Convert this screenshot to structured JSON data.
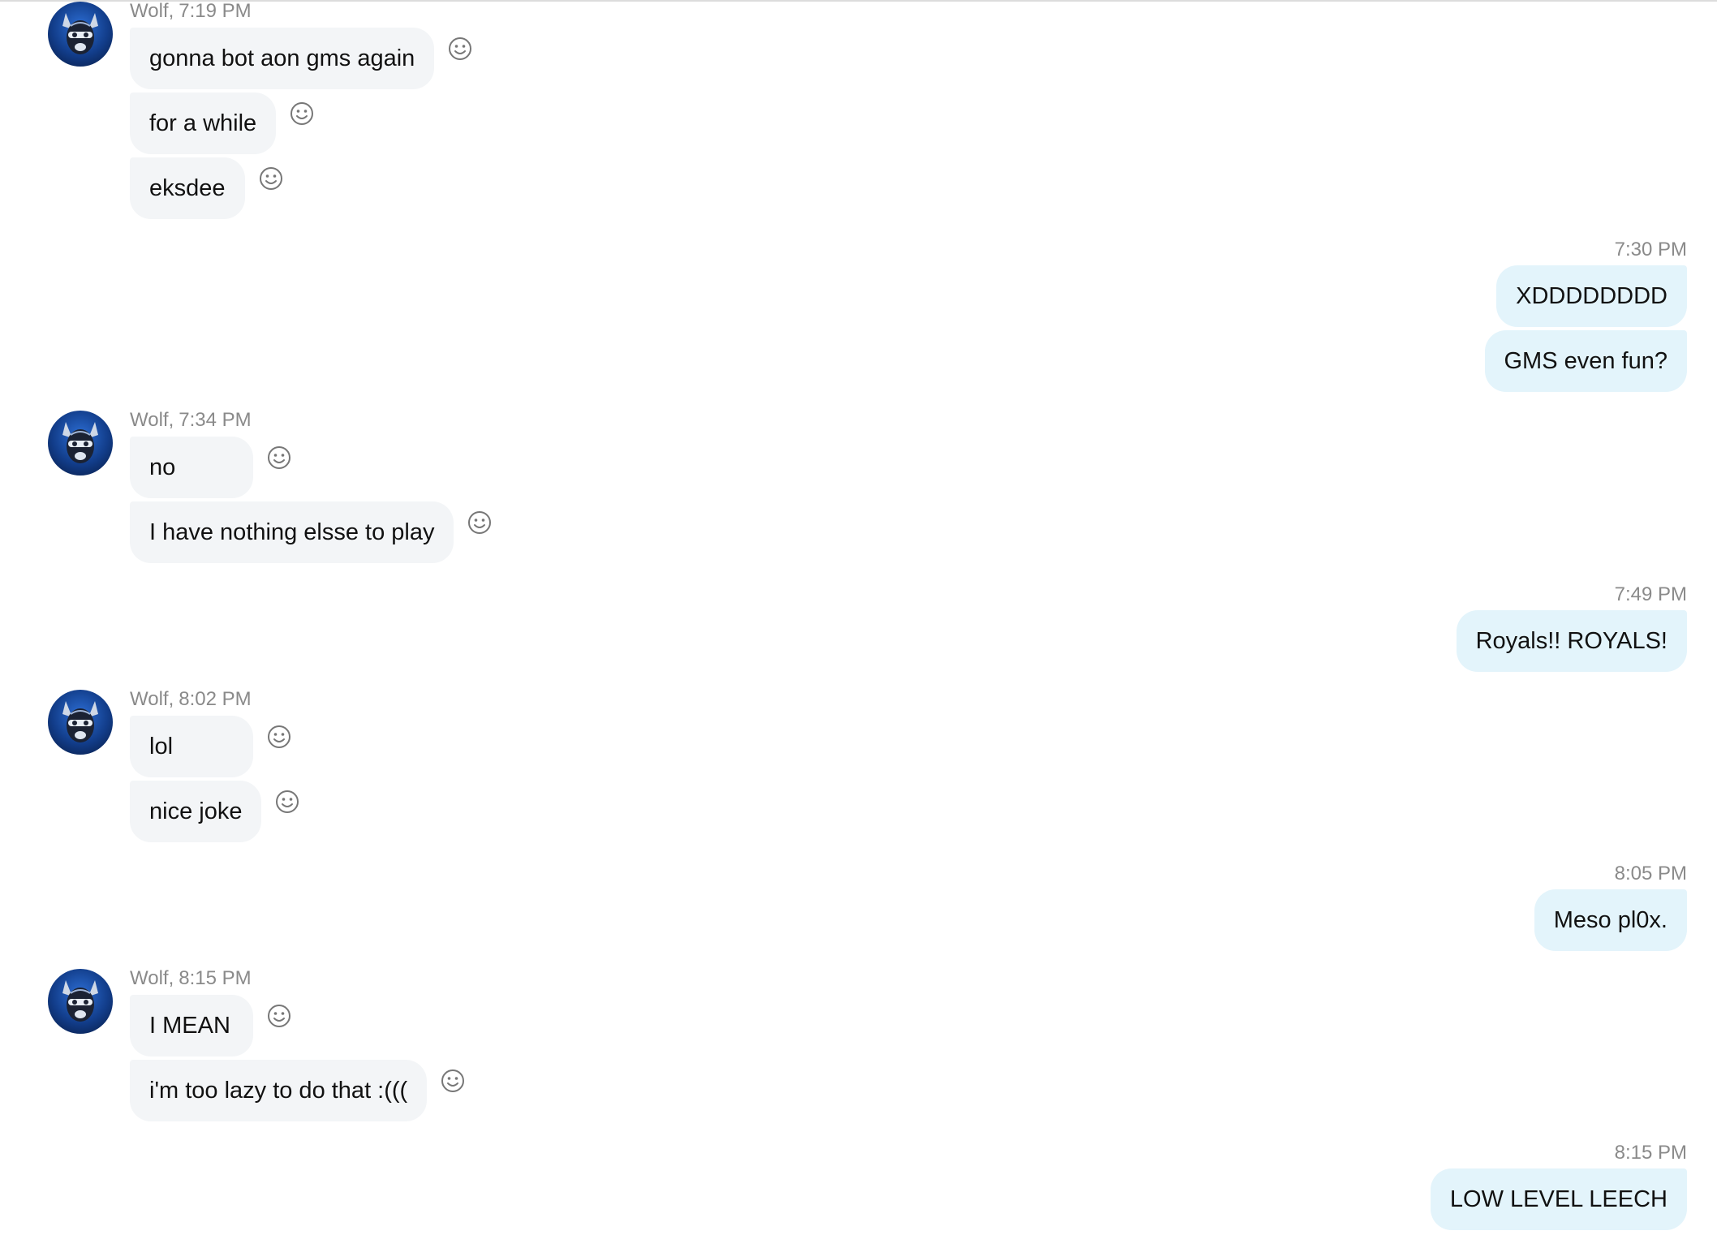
{
  "contact": {
    "name": "Wolf"
  },
  "incoming": [
    {
      "sender": "Wolf",
      "time": "7:19 PM",
      "messages": [
        "gonna bot aon gms again",
        "for a while",
        "eksdee"
      ]
    },
    {
      "sender": "Wolf",
      "time": "7:34 PM",
      "messages": [
        "no",
        "I have nothing elsse to play"
      ]
    },
    {
      "sender": "Wolf",
      "time": "8:02 PM",
      "messages": [
        "lol",
        "nice joke"
      ]
    },
    {
      "sender": "Wolf",
      "time": "8:15 PM",
      "messages": [
        "I MEAN",
        "i'm too lazy to do that :((("
      ]
    }
  ],
  "outgoing": [
    {
      "time": "7:30 PM",
      "messages": [
        "XDDDDDDDD",
        "GMS even fun?"
      ]
    },
    {
      "time": "7:49 PM",
      "messages": [
        "Royals!! ROYALS!"
      ]
    },
    {
      "time": "8:05 PM",
      "messages": [
        "Meso pl0x."
      ]
    },
    {
      "time": "8:15 PM",
      "messages": [
        "LOW LEVEL LEECH"
      ]
    }
  ],
  "icons": {
    "reaction": "smiley-icon",
    "avatar": "wolf-avatar"
  },
  "colors": {
    "incoming_bubble": "#f3f5f7",
    "outgoing_bubble": "#e3f4fb",
    "timestamp": "#8a8a8a"
  }
}
